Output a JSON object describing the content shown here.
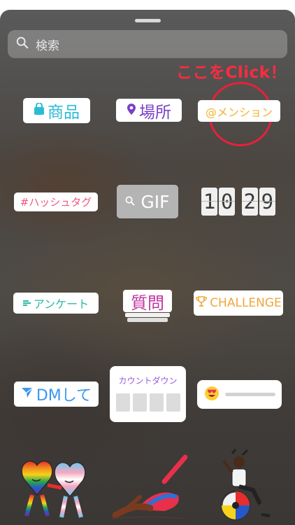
{
  "search": {
    "placeholder": "検索",
    "icon": "search-icon"
  },
  "annotation": {
    "text": "ここをClick！",
    "color": "#ff2b40"
  },
  "stickers": {
    "products": {
      "label": "商品",
      "icon": "shopping-bag-icon",
      "color": "#2abbd6"
    },
    "location": {
      "label": "場所",
      "icon": "location-pin-icon",
      "color": "#7b3fc7"
    },
    "mention": {
      "label": "@メンション",
      "color": "#f2b32e"
    },
    "hashtag": {
      "label": "#ハッシュタグ",
      "color": "#ee5a86"
    },
    "gif": {
      "label": "GIF",
      "icon": "search-icon"
    },
    "clock": {
      "digits": [
        "1",
        "0",
        "2",
        "9"
      ]
    },
    "poll": {
      "label": "アンケート",
      "icon": "poll-lines-icon",
      "color": "#2cb9a4"
    },
    "question": {
      "label": "質問",
      "color": "#c236a3"
    },
    "challenge": {
      "label": "CHALLENGE",
      "icon": "trophy-icon",
      "color": "#efa73c"
    },
    "dm": {
      "label": "DMして",
      "icon": "paper-plane-icon",
      "color": "#3b97f0"
    },
    "countdown": {
      "label": "カウントダウン",
      "color": "#9b59d8"
    },
    "emoji_slider": {
      "emoji": "😍",
      "icon": "heart-eyes-emoji-icon"
    }
  },
  "artwork": [
    "pride-hearts-sticker",
    "swimmer-sticker",
    "wheelchair-user-sticker"
  ]
}
